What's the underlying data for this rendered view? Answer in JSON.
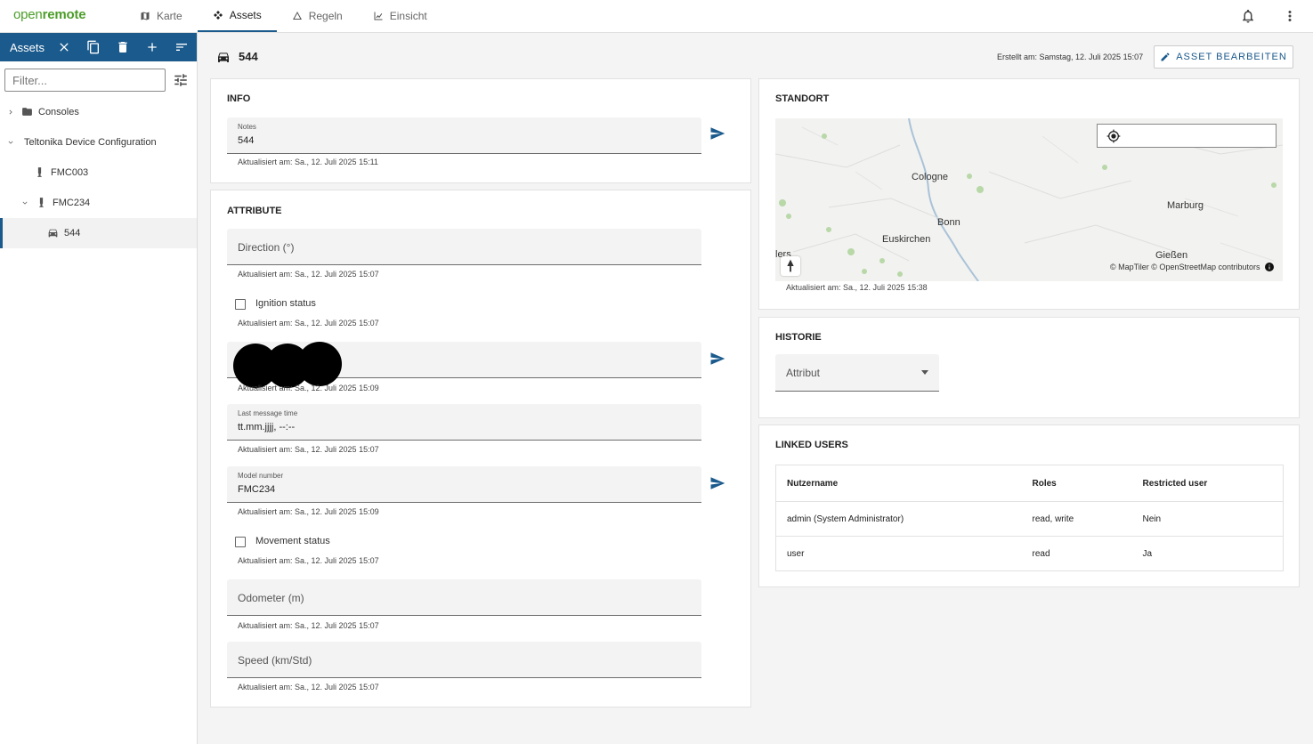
{
  "app": {
    "logo_part1": "open",
    "logo_part2": "remote"
  },
  "nav": {
    "items": [
      {
        "label": "Karte",
        "icon": "map-icon"
      },
      {
        "label": "Assets",
        "icon": "assets-icon"
      },
      {
        "label": "Regeln",
        "icon": "rules-icon"
      },
      {
        "label": "Einsicht",
        "icon": "insights-icon"
      }
    ],
    "active": "Assets"
  },
  "sidebar": {
    "title": "Assets",
    "filter_placeholder": "Filter...",
    "tree": [
      {
        "label": "Consoles",
        "icon": "folder-icon",
        "level": 0,
        "expanded": false
      },
      {
        "label": "Teltonika Device Configuration",
        "icon": "none",
        "level": 0,
        "expanded": true
      },
      {
        "label": "FMC003",
        "icon": "device-icon",
        "level": 1
      },
      {
        "label": "FMC234",
        "icon": "device-icon",
        "level": 1,
        "expanded": true
      },
      {
        "label": "544",
        "icon": "car-icon",
        "level": 2,
        "selected": true
      }
    ]
  },
  "asset": {
    "name": "544",
    "created": "Erstellt am: Samstag, 12. Juli 2025 15:07",
    "edit_label": "ASSET BEARBEITEN"
  },
  "info": {
    "title": "INFO",
    "notes_label": "Notes",
    "notes_value": "544",
    "notes_updated": "Aktualisiert am: Sa., 12. Juli 2025 15:11"
  },
  "attributes": {
    "title": "ATTRIBUTE",
    "direction_placeholder": "Direction (°)",
    "direction_updated": "Aktualisiert am: Sa., 12. Juli 2025 15:07",
    "ignition_label": "Ignition status",
    "ignition_updated": "Aktualisiert am: Sa., 12. Juli 2025 15:07",
    "redacted_updated": "Aktualisiert am: Sa., 12. Juli 2025 15:09",
    "last_message_label": "Last message time",
    "last_message_value": "tt.mm.jjjj, --:--",
    "last_message_updated": "Aktualisiert am: Sa., 12. Juli 2025 15:07",
    "model_label": "Model number",
    "model_value": "FMC234",
    "model_updated": "Aktualisiert am: Sa., 12. Juli 2025 15:09",
    "movement_label": "Movement status",
    "movement_updated": "Aktualisiert am: Sa., 12. Juli 2025 15:07",
    "odometer_placeholder": "Odometer (m)",
    "odometer_updated": "Aktualisiert am: Sa., 12. Juli 2025 15:07",
    "speed_placeholder": "Speed (km/Std)",
    "speed_updated": "Aktualisiert am: Sa., 12. Juli 2025 15:07"
  },
  "location": {
    "title": "STANDORT",
    "cities": [
      "Cologne",
      "Bonn",
      "Euskirchen",
      "Marburg",
      "Gießen",
      "lers"
    ],
    "attribution": "© MapTiler © OpenStreetMap contributors",
    "updated": "Aktualisiert am: Sa., 12. Juli 2025 15:38"
  },
  "history": {
    "title": "HISTORIE",
    "select_placeholder": "Attribut"
  },
  "linked_users": {
    "title": "LINKED USERS",
    "columns": [
      "Nutzername",
      "Roles",
      "Restricted user"
    ],
    "rows": [
      [
        "admin (System Administrator)",
        "read, write",
        "Nein"
      ],
      [
        "user",
        "read",
        "Ja"
      ]
    ]
  },
  "colors": {
    "primary": "#1b5a8c",
    "brand_green": "#4d9d2a"
  }
}
